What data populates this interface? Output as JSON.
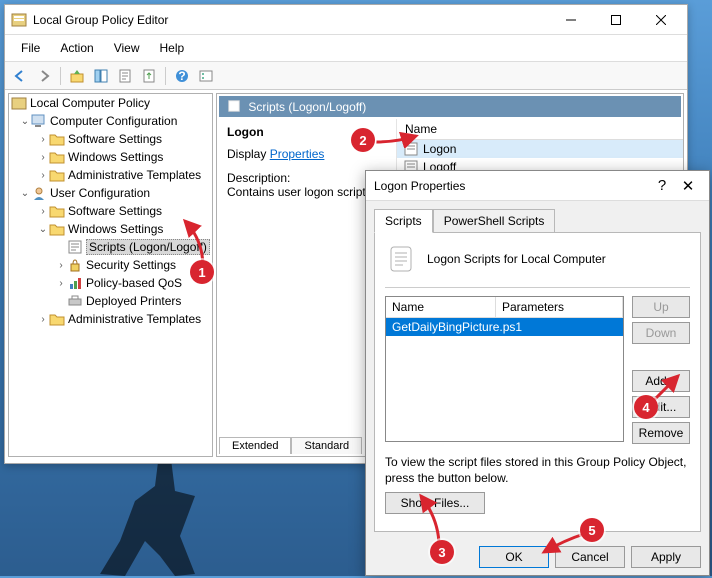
{
  "window": {
    "title": "Local Group Policy Editor",
    "menu": [
      "File",
      "Action",
      "View",
      "Help"
    ]
  },
  "tree": {
    "root": "Local Computer Policy",
    "comp": "Computer Configuration",
    "sw": "Software Settings",
    "ws": "Windows Settings",
    "at": "Administrative Templates",
    "user": "User Configuration",
    "sw2": "Software Settings",
    "ws2": "Windows Settings",
    "scripts": "Scripts (Logon/Logoff)",
    "security": "Security Settings",
    "qos": "Policy-based QoS",
    "printers": "Deployed Printers",
    "at2": "Administrative Templates"
  },
  "detail": {
    "header": "Scripts (Logon/Logoff)",
    "category": "Logon",
    "display_label": "Display",
    "properties_link": "Properties",
    "desc_label": "Description:",
    "desc_text": "Contains user logon scripts.",
    "col_name": "Name",
    "items": [
      "Logon",
      "Logoff"
    ],
    "tabs": [
      "Extended",
      "Standard"
    ]
  },
  "props": {
    "title": "Logon Properties",
    "tabs": [
      "Scripts",
      "PowerShell Scripts"
    ],
    "heading": "Logon Scripts for Local Computer",
    "col_name": "Name",
    "col_params": "Parameters",
    "script_entry": "GetDailyBingPicture.ps1",
    "btns": {
      "up": "Up",
      "down": "Down",
      "add": "Add...",
      "edit": "Edit...",
      "remove": "Remove"
    },
    "hint": "To view the script files stored in this Group Policy Object, press the button below.",
    "showfiles": "Show Files...",
    "ok": "OK",
    "cancel": "Cancel",
    "apply": "Apply"
  },
  "annotations": {
    "1": "1",
    "2": "2",
    "3": "3",
    "4": "4",
    "5": "5"
  }
}
